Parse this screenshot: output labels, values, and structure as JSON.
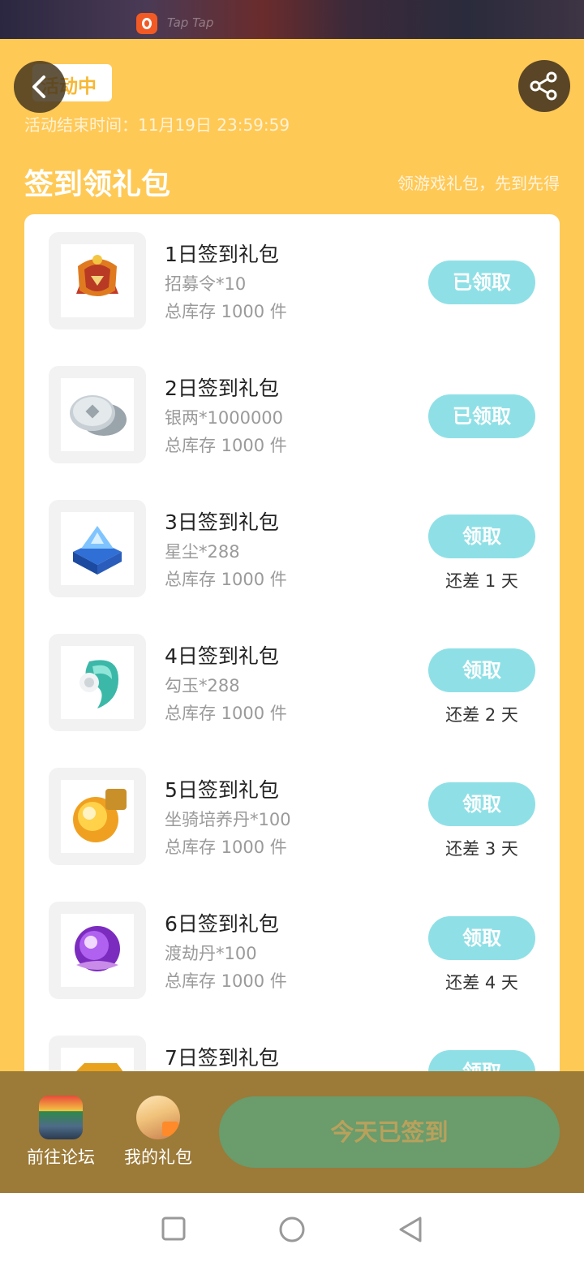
{
  "statusbar": {
    "app_label": "Tap  Tap"
  },
  "header": {
    "status_pill": "活动中",
    "end_time": "活动结束时间：11月19日 23:59:59",
    "section_title": "签到领礼包",
    "section_subtitle": "领游戏礼包，先到先得"
  },
  "gifts": [
    {
      "title": "1日签到礼包",
      "item": "招募令*10",
      "stock": "总库存 1000 件",
      "button": "已领取",
      "days_left": ""
    },
    {
      "title": "2日签到礼包",
      "item": "银两*1000000",
      "stock": "总库存 1000 件",
      "button": "已领取",
      "days_left": ""
    },
    {
      "title": "3日签到礼包",
      "item": "星尘*288",
      "stock": "总库存 1000 件",
      "button": "领取",
      "days_left": "还差 1 天"
    },
    {
      "title": "4日签到礼包",
      "item": "勾玉*288",
      "stock": "总库存 1000 件",
      "button": "领取",
      "days_left": "还差 2 天"
    },
    {
      "title": "5日签到礼包",
      "item": "坐骑培养丹*100",
      "stock": "总库存 1000 件",
      "button": "领取",
      "days_left": "还差 3 天"
    },
    {
      "title": "6日签到礼包",
      "item": "渡劫丹*100",
      "stock": "总库存 1000 件",
      "button": "领取",
      "days_left": "还差 4 天"
    },
    {
      "title": "7日签到礼包",
      "item": "",
      "stock": "",
      "button": "领取",
      "days_left": ""
    }
  ],
  "bottom": {
    "forum_label": "前往论坛",
    "mygift_label": "我的礼包",
    "signed_label": "今天已签到"
  },
  "colors": {
    "page_bg": "#ffc956",
    "claim_button": "#8fe0e6",
    "signed_button": "#6a9c6c",
    "bottom_bar": "#9c7a38"
  },
  "icons": {
    "back": "chevron-left-icon",
    "share": "share-icon",
    "gift_1": "recruit-token-icon",
    "gift_2": "silver-coin-icon",
    "gift_3": "stardust-chest-icon",
    "gift_4": "jade-magatama-icon",
    "gift_5": "mount-pill-icon",
    "gift_6": "tribulation-pill-icon",
    "gift_7": "gold-bar-icon"
  }
}
